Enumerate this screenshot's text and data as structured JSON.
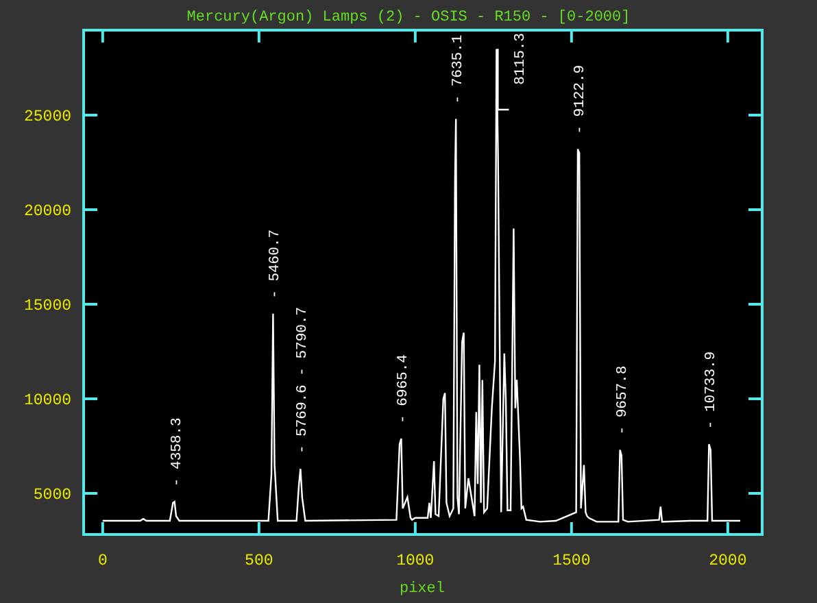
{
  "plot": {
    "chart_data": {
      "type": "line",
      "title": "Mercury(Argon) Lamps (2) - OSIS - R150 - [0-2000]",
      "xlabel": "pixel",
      "xlim": [
        -61,
        2110
      ],
      "ylim": [
        2826,
        29490
      ],
      "xticks": [
        0,
        500,
        1000,
        1500,
        2000
      ],
      "yticks": [
        5000,
        10000,
        15000,
        20000,
        25000
      ],
      "x": [
        0,
        120,
        130,
        140,
        215,
        225,
        230,
        235,
        245,
        530,
        540,
        545,
        550,
        560,
        620,
        628,
        633,
        638,
        648,
        940,
        950,
        955,
        960,
        975,
        985,
        990,
        1000,
        1040,
        1045,
        1050,
        1060,
        1065,
        1075,
        1090,
        1095,
        1100,
        1110,
        1122,
        1127,
        1130,
        1135,
        1140,
        1150,
        1155,
        1160,
        1170,
        1190,
        1195,
        1200,
        1205,
        1210,
        1215,
        1220,
        1230,
        1245,
        1255,
        1260,
        1265,
        1275,
        1285,
        1290,
        1295,
        1305,
        1315,
        1320,
        1325,
        1335,
        1340,
        1345,
        1355,
        1400,
        1450,
        1515,
        1520,
        1525,
        1530,
        1540,
        1545,
        1550,
        1555,
        1580,
        1650,
        1655,
        1660,
        1665,
        1680,
        1780,
        1785,
        1790,
        1880,
        1935,
        1940,
        1945,
        1950,
        1960,
        2040
      ],
      "series": [
        {
          "color": "#ffffff",
          "values": [
            3550,
            3550,
            3650,
            3550,
            3550,
            4500,
            4560,
            3800,
            3550,
            3550,
            6000,
            14500,
            6500,
            3550,
            3550,
            5500,
            6300,
            4800,
            3550,
            3600,
            7600,
            7900,
            4200,
            4800,
            3700,
            3600,
            3700,
            3700,
            4500,
            3700,
            6700,
            3900,
            3800,
            10000,
            10300,
            4500,
            3800,
            4200,
            21500,
            24800,
            4800,
            3900,
            13000,
            13500,
            4200,
            5800,
            3800,
            9300,
            5500,
            11800,
            4500,
            11000,
            4000,
            4200,
            9500,
            12000,
            28500,
            23000,
            4000,
            12400,
            10000,
            4100,
            4100,
            19000,
            9500,
            11000,
            6900,
            4200,
            4300,
            3600,
            3500,
            3550,
            4000,
            23200,
            23000,
            4200,
            6500,
            4000,
            3800,
            3700,
            3500,
            3500,
            7300,
            7000,
            3600,
            3500,
            3600,
            4300,
            3500,
            3550,
            3550,
            7600,
            7300,
            3550,
            3550,
            3550
          ]
        }
      ],
      "annotations": [
        {
          "x": 230,
          "y": 4560,
          "text": "- 4358.3"
        },
        {
          "x": 545,
          "y": 14500,
          "text": "- 5460.7"
        },
        {
          "x": 633,
          "y": 6300,
          "text": "- 5769.6 - 5790.7"
        },
        {
          "x": 955,
          "y": 7900,
          "text": "- 6965.4"
        },
        {
          "x": 1130,
          "y": 24800,
          "text": "- 7635.1"
        },
        {
          "x": 1260,
          "y": 28500,
          "text": "8115.3"
        },
        {
          "x": 1520,
          "y": 23200,
          "text": "- 9122.9"
        },
        {
          "x": 1655,
          "y": 7300,
          "text": "- 9657.8"
        },
        {
          "x": 1940,
          "y": 7600,
          "text": "- 10733.9"
        }
      ]
    }
  }
}
